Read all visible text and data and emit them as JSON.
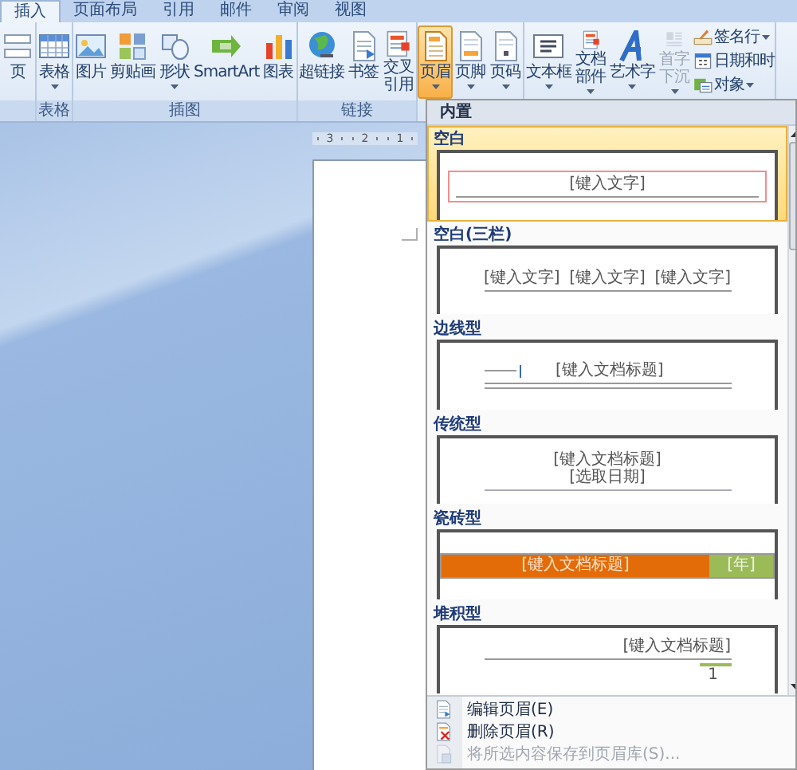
{
  "tabs": [
    {
      "label": "插入",
      "selected": true
    },
    {
      "label": "页面布局",
      "selected": false
    },
    {
      "label": "引用",
      "selected": false
    },
    {
      "label": "邮件",
      "selected": false
    },
    {
      "label": "审阅",
      "selected": false
    },
    {
      "label": "视图",
      "selected": false
    }
  ],
  "ribbon": {
    "groups": [
      {
        "buttons": [
          {
            "label": "页",
            "dropdown": false,
            "pressed": false,
            "disabled": false
          }
        ]
      },
      {
        "label": "表格",
        "buttons": [
          {
            "label": "表格",
            "dropdown": true,
            "pressed": false,
            "disabled": false
          }
        ]
      },
      {
        "label": "插图",
        "buttons": [
          {
            "label": "图片",
            "dropdown": false,
            "pressed": false,
            "disabled": false
          },
          {
            "label": "剪贴画",
            "dropdown": false,
            "pressed": false,
            "disabled": false
          },
          {
            "label": "形状",
            "dropdown": true,
            "pressed": false,
            "disabled": false
          },
          {
            "label": "SmartArt",
            "dropdown": false,
            "pressed": false,
            "disabled": false
          },
          {
            "label": "图表",
            "dropdown": false,
            "pressed": false,
            "disabled": false
          }
        ]
      },
      {
        "label": "链接",
        "buttons": [
          {
            "label": "超链接",
            "dropdown": false,
            "pressed": false,
            "disabled": false
          },
          {
            "label": "书签",
            "dropdown": false,
            "pressed": false,
            "disabled": false
          },
          {
            "label": "交叉引用",
            "dropdown": false,
            "pressed": false,
            "disabled": false
          }
        ]
      },
      {
        "buttons": [
          {
            "label": "页眉",
            "dropdown": true,
            "pressed": true,
            "disabled": false
          },
          {
            "label": "页脚",
            "dropdown": true,
            "pressed": false,
            "disabled": false
          },
          {
            "label": "页码",
            "dropdown": true,
            "pressed": false,
            "disabled": false
          }
        ]
      },
      {
        "buttons": [
          {
            "label": "文本框",
            "dropdown": true,
            "pressed": false,
            "disabled": false
          },
          {
            "label": "文档部件",
            "dropdown": true,
            "pressed": false,
            "disabled": false
          },
          {
            "label": "艺术字",
            "dropdown": true,
            "pressed": false,
            "disabled": false
          },
          {
            "label": "首字下沉",
            "dropdown": true,
            "pressed": false,
            "disabled": true
          }
        ],
        "small": [
          {
            "label": "签名行",
            "dropdown": true
          },
          {
            "label": "日期和时",
            "dropdown": false
          },
          {
            "label": "对象",
            "dropdown": true
          }
        ]
      }
    ]
  },
  "ruler": [
    "3",
    "2",
    "1"
  ],
  "header_gallery": {
    "section": "内置",
    "items": [
      {
        "label": "空白",
        "selected": true,
        "kind": "blank",
        "texts": [
          "[键入文字]"
        ]
      },
      {
        "label": "空白(三栏)",
        "selected": false,
        "kind": "three",
        "texts": [
          "[键入文字]",
          "[键入文字]",
          "[键入文字]"
        ]
      },
      {
        "label": "边线型",
        "selected": false,
        "kind": "sideline",
        "texts": [
          "[键入文档标题]"
        ]
      },
      {
        "label": "传统型",
        "selected": false,
        "kind": "traditional",
        "texts": [
          "[键入文档标题]",
          "[选取日期]"
        ]
      },
      {
        "label": "瓷砖型",
        "selected": false,
        "kind": "tile",
        "texts": [
          "[键入文档标题]",
          "[年]"
        ]
      },
      {
        "label": "堆积型",
        "selected": false,
        "kind": "stacked",
        "texts": [
          "[键入文档标题]",
          "1"
        ]
      }
    ],
    "menu": [
      {
        "label": "编辑页眉(E)",
        "disabled": false
      },
      {
        "label": "删除页眉(R)",
        "disabled": false
      },
      {
        "label": "将所选内容保存到页眉库(S)...",
        "disabled": true
      }
    ]
  }
}
